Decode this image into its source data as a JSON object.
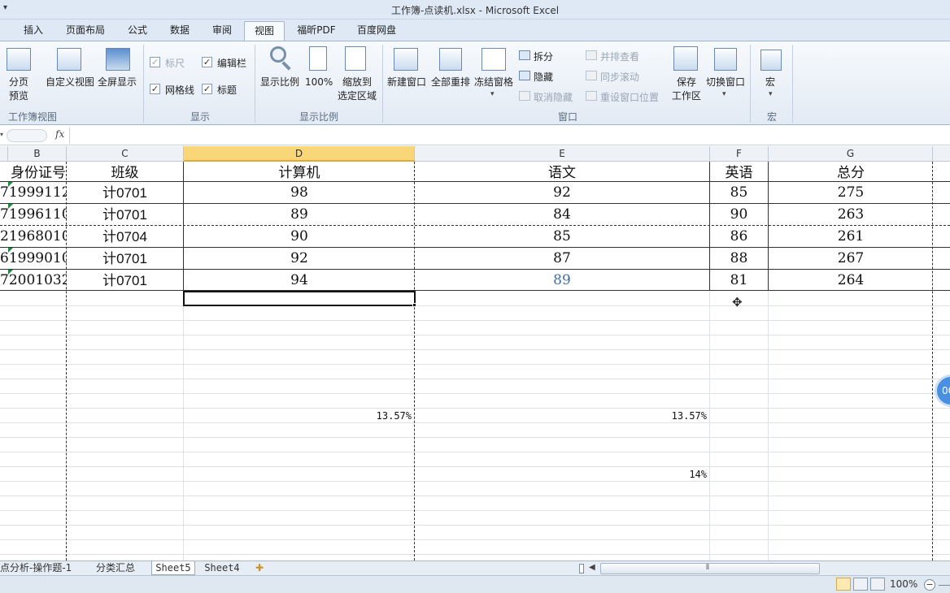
{
  "window": {
    "title": "工作簿-点读机.xlsx -  Microsoft Excel"
  },
  "tabs": [
    "插入",
    "页面布局",
    "公式",
    "数据",
    "审阅",
    "视图",
    "福昕PDF",
    "百度网盘"
  ],
  "active_tab": "视图",
  "ribbon": {
    "workbook_views": {
      "group": "工作簿视图",
      "page_break": "分页\n预览",
      "custom_view": "自定义视图",
      "full_screen": "全屏显示"
    },
    "show": {
      "group": "显示",
      "ruler": "标尺",
      "formula_bar": "编辑栏",
      "gridlines": "网格线",
      "headings": "标题"
    },
    "zoom": {
      "group": "显示比例",
      "zoom": "显示比例",
      "zoom100": "100%",
      "zoom_selection": "缩放到\n选定区域"
    },
    "window": {
      "group": "窗口",
      "new_window": "新建窗口",
      "arrange_all": "全部重排",
      "freeze": "冻结窗格",
      "split": "拆分",
      "hide": "隐藏",
      "unhide": "取消隐藏",
      "side_by_side": "并排查看",
      "sync_scroll": "同步滚动",
      "reset_position": "重设窗口位置",
      "save_workspace": "保存\n工作区",
      "switch_windows": "切换窗口"
    },
    "macros": {
      "group": "宏",
      "macros": "宏"
    }
  },
  "columns": [
    "B",
    "C",
    "D",
    "E",
    "F",
    "G"
  ],
  "selected_column": "D",
  "table": {
    "headers": [
      "身份证号",
      "班级",
      "计算机",
      "语文",
      "英语",
      "总分"
    ],
    "rows": [
      [
        "71999112",
        "计0701",
        "98",
        "92",
        "85",
        "275"
      ],
      [
        "71996110",
        "计0701",
        "89",
        "84",
        "90",
        "263"
      ],
      [
        "21968010",
        "计0704",
        "90",
        "85",
        "86",
        "261"
      ],
      [
        "61999010",
        "计0701",
        "92",
        "87",
        "88",
        "267"
      ],
      [
        "72001032",
        "计0701",
        "94",
        "89",
        "81",
        "264"
      ]
    ]
  },
  "percent_labels": [
    "13.57%",
    "13.57%",
    "14%"
  ],
  "sheet_tabs": [
    "点分析-操作题-1",
    "分类汇总",
    "Sheet5",
    "Sheet4"
  ],
  "status": {
    "zoom": "100%"
  },
  "float_widget": "00"
}
